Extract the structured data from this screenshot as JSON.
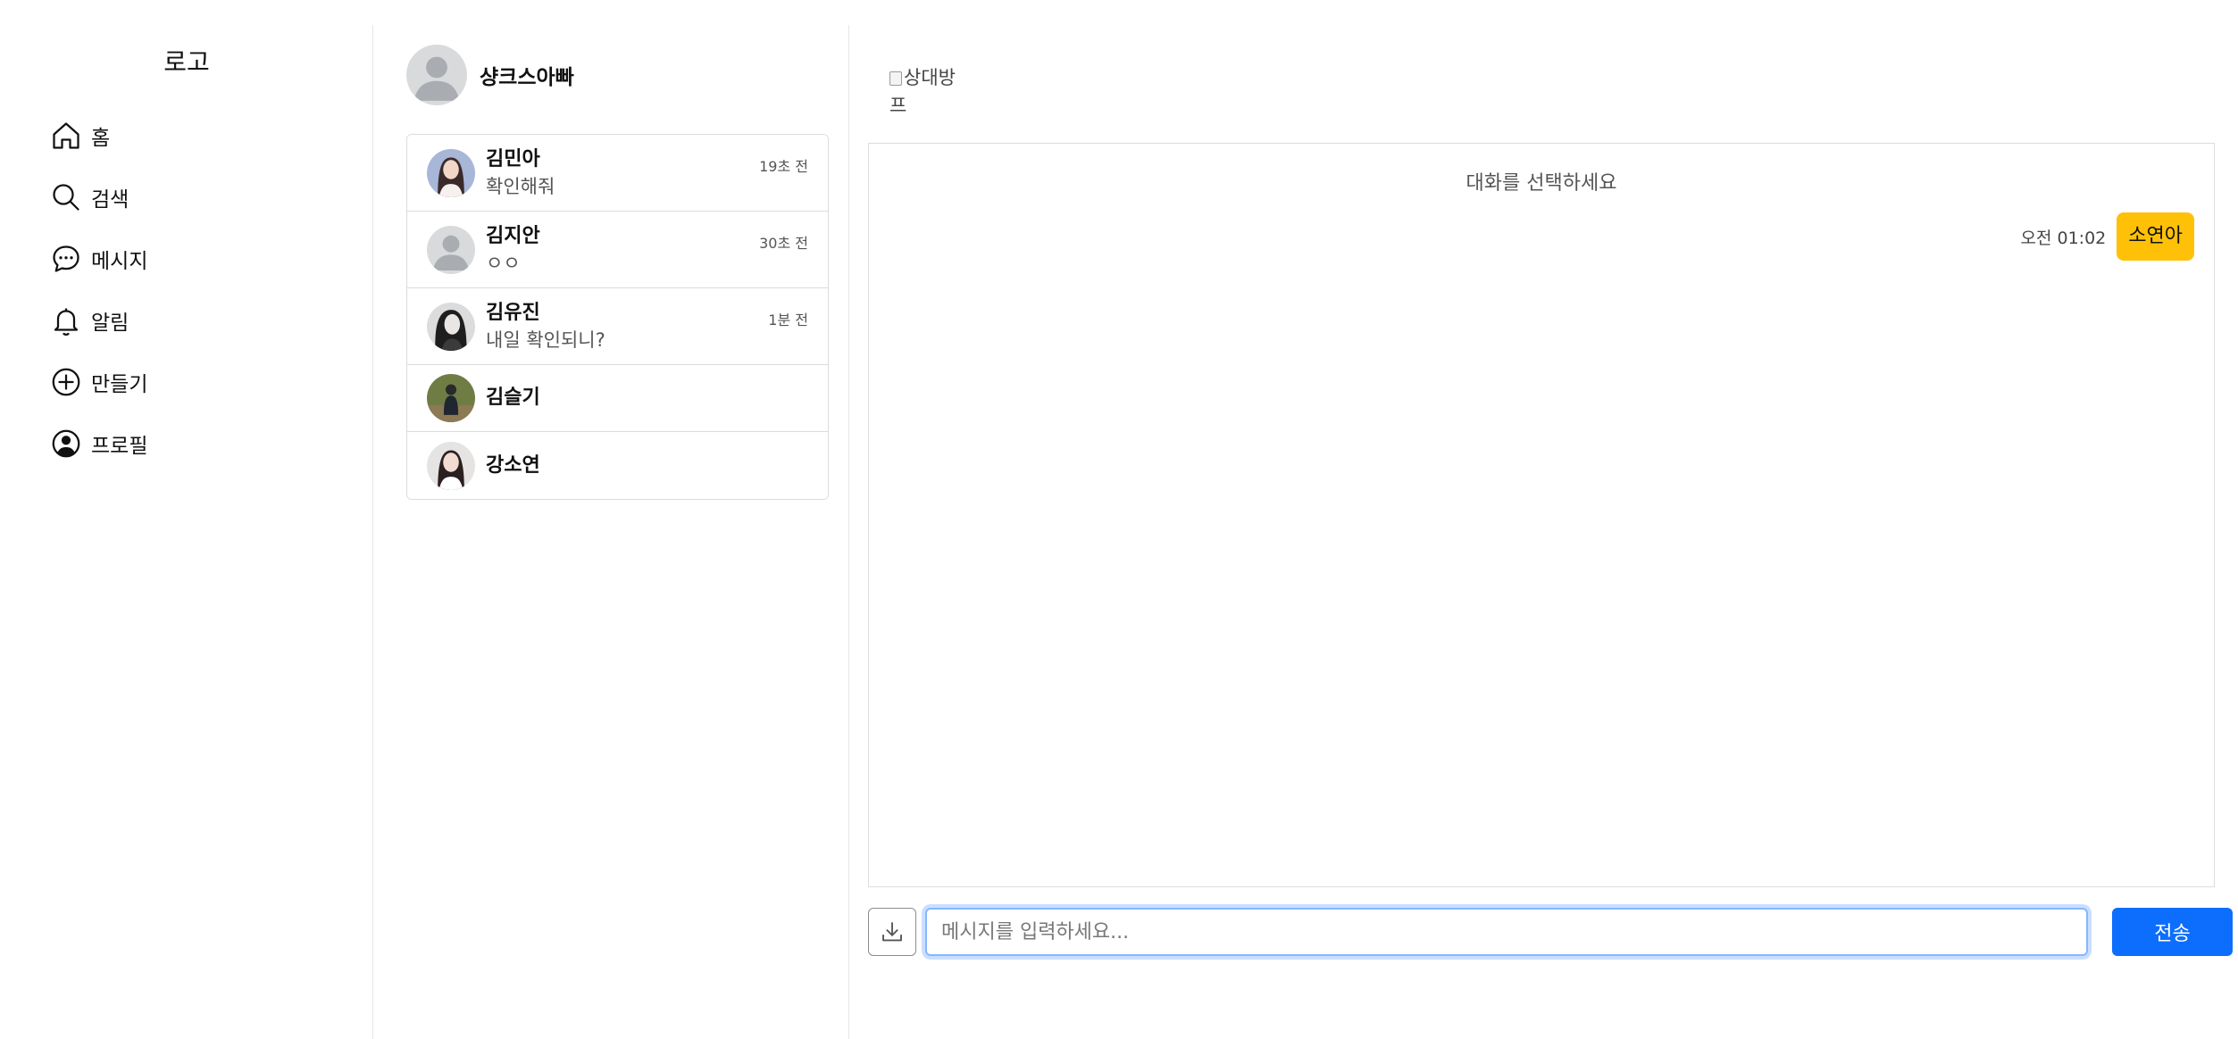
{
  "nav": {
    "logo": "로고",
    "items": [
      {
        "label": "홈",
        "icon": "home-icon"
      },
      {
        "label": "검색",
        "icon": "search-icon"
      },
      {
        "label": "메시지",
        "icon": "message-icon"
      },
      {
        "label": "알림",
        "icon": "bell-icon"
      },
      {
        "label": "만들기",
        "icon": "plus-circle-icon"
      },
      {
        "label": "프로필",
        "icon": "profile-icon"
      }
    ]
  },
  "me": {
    "name": "샹크스아빠"
  },
  "conversations": [
    {
      "name": "김민아",
      "preview": "확인해줘",
      "time": "19초 전"
    },
    {
      "name": "김지안",
      "preview": "ㅇㅇ",
      "time": "30초 전"
    },
    {
      "name": "김유진",
      "preview": "내일 확인되니?",
      "time": "1분 전"
    },
    {
      "name": "김슬기",
      "preview": "",
      "time": ""
    },
    {
      "name": "강소연",
      "preview": "",
      "time": ""
    }
  ],
  "chat": {
    "peer_image_alt": "상대방 프",
    "empty_hint": "대화를 선택하세요",
    "messages": [
      {
        "time": "오전 01:02",
        "text": "소연아"
      }
    ],
    "input_placeholder": "메시지를 입력하세요...",
    "send_label": "전송"
  },
  "colors": {
    "send_button": "#0d6efd",
    "bubble": "#ffc107",
    "input_focus": "#86b7fe"
  }
}
